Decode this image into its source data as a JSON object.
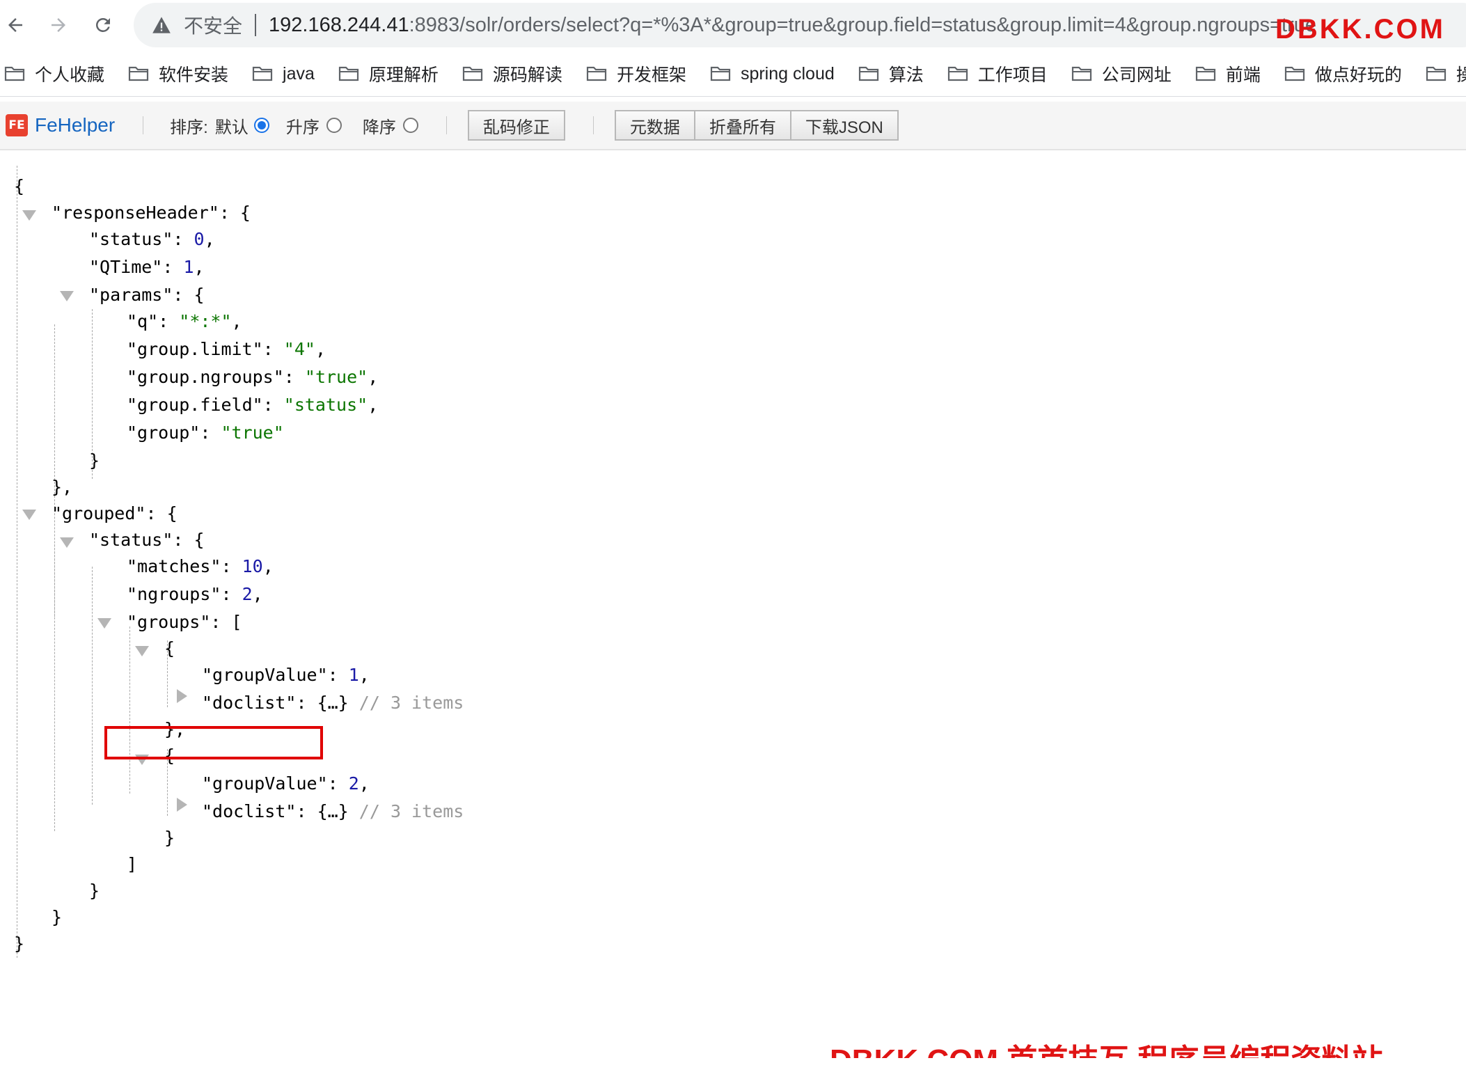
{
  "browser": {
    "security_label": "不安全",
    "url_host": "192.168.244.41",
    "url_rest": ":8983/solr/orders/select?q=*%3A*&group=true&group.field=status&group.limit=4&group.ngroups=true"
  },
  "watermark": {
    "top": "DBKK.COM",
    "bottom": "DBKK.COM 首首技互 程序员编程资料站"
  },
  "bookmarks": [
    "个人收藏",
    "软件安装",
    "java",
    "原理解析",
    "源码解读",
    "开发框架",
    "spring cloud",
    "算法",
    "工作项目",
    "公司网址",
    "前端",
    "做点好玩的",
    "操"
  ],
  "fehelper": {
    "logo": "FE",
    "title": "FeHelper",
    "sort_label": "排序:",
    "sort_default": "默认",
    "sort_asc": "升序",
    "sort_desc": "降序",
    "fix_encoding": "乱码修正",
    "metadata": "元数据",
    "collapse_all": "折叠所有",
    "download_json": "下载JSON"
  },
  "json": {
    "open_brace": "{",
    "responseHeader_key": "\"responseHeader\"",
    "status_key": "\"status\"",
    "status_val": "0",
    "qtime_key": "\"QTime\"",
    "qtime_val": "1",
    "params_key": "\"params\"",
    "q_key": "\"q\"",
    "q_val": "\"*:*\"",
    "glimit_key": "\"group.limit\"",
    "glimit_val": "\"4\"",
    "gngroups_key": "\"group.ngroups\"",
    "gngroups_val": "\"true\"",
    "gfield_key": "\"group.field\"",
    "gfield_val": "\"status\"",
    "group_key": "\"group\"",
    "group_val": "\"true\"",
    "grouped_key": "\"grouped\"",
    "gstatus_key": "\"status\"",
    "matches_key": "\"matches\"",
    "matches_val": "10",
    "ngroups_key": "\"ngroups\"",
    "ngroups_val": "2",
    "groups_key": "\"groups\"",
    "groupValue_key": "\"groupValue\"",
    "g1_value": "1",
    "g2_value": "2",
    "doclist_key": "\"doclist\"",
    "collapsed": "{…}",
    "items_comment": "// 3 items"
  }
}
